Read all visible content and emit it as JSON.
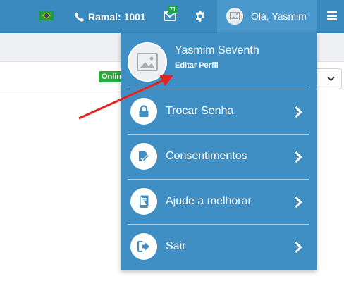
{
  "topbar": {
    "flag_icon": "brazil-flag-icon",
    "phone_label": "Ramal: 1001",
    "mail_badge": "71",
    "greeting": "Olá, Yasmim"
  },
  "content": {
    "online_badge": "Onlin"
  },
  "dropdown": {
    "user_name": "Yasmim Seventh",
    "edit_profile": "Editar Perfil",
    "items": [
      {
        "label": "Trocar Senha",
        "icon": "lock-icon"
      },
      {
        "label": "Consentimentos",
        "icon": "signature-icon"
      },
      {
        "label": "Ajude a melhorar",
        "icon": "book-icon"
      },
      {
        "label": "Sair",
        "icon": "sign-out-icon"
      }
    ]
  },
  "colors": {
    "topbar": "#3a89bf",
    "dropdown": "#3f8ec4",
    "icon_blue": "#3f8ec4",
    "online_green": "#2bab3f",
    "annotation_red": "#e8231f"
  }
}
